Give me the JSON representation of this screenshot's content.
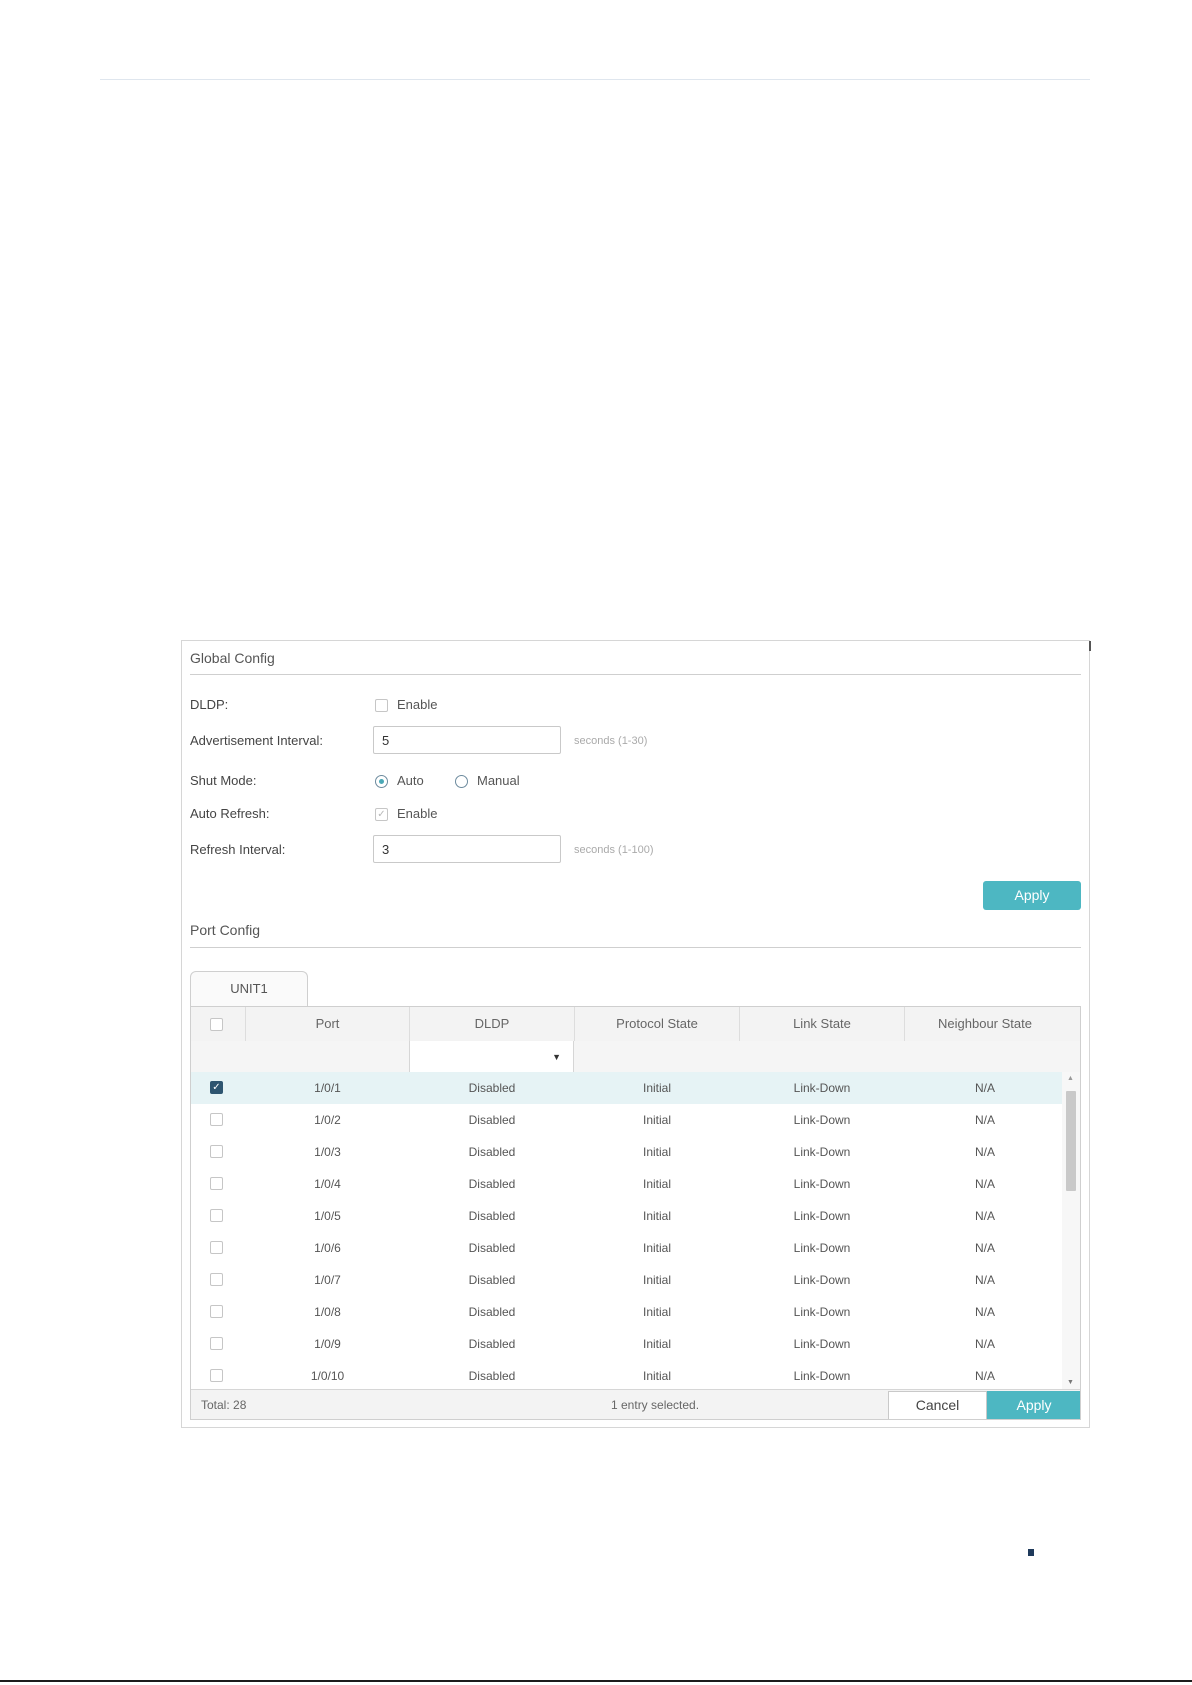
{
  "global_config": {
    "title": "Global Config",
    "dldp": {
      "label": "DLDP:",
      "option": "Enable",
      "checked": false
    },
    "advertisement_interval": {
      "label": "Advertisement Interval:",
      "value": "5",
      "hint": "seconds (1-30)"
    },
    "shut_mode": {
      "label": "Shut Mode:",
      "options": [
        "Auto",
        "Manual"
      ],
      "selected": "Auto"
    },
    "auto_refresh": {
      "label": "Auto Refresh:",
      "option": "Enable",
      "checked": true
    },
    "refresh_interval": {
      "label": "Refresh Interval:",
      "value": "3",
      "hint": "seconds (1-100)"
    },
    "apply_label": "Apply"
  },
  "port_config": {
    "title": "Port Config",
    "tab": "UNIT1",
    "columns": [
      "Port",
      "DLDP",
      "Protocol State",
      "Link State",
      "Neighbour State"
    ],
    "filter_value": "",
    "rows": [
      {
        "port": "1/0/1",
        "dldp": "Disabled",
        "protocol_state": "Initial",
        "link_state": "Link-Down",
        "neighbour_state": "N/A",
        "checked": true
      },
      {
        "port": "1/0/2",
        "dldp": "Disabled",
        "protocol_state": "Initial",
        "link_state": "Link-Down",
        "neighbour_state": "N/A",
        "checked": false
      },
      {
        "port": "1/0/3",
        "dldp": "Disabled",
        "protocol_state": "Initial",
        "link_state": "Link-Down",
        "neighbour_state": "N/A",
        "checked": false
      },
      {
        "port": "1/0/4",
        "dldp": "Disabled",
        "protocol_state": "Initial",
        "link_state": "Link-Down",
        "neighbour_state": "N/A",
        "checked": false
      },
      {
        "port": "1/0/5",
        "dldp": "Disabled",
        "protocol_state": "Initial",
        "link_state": "Link-Down",
        "neighbour_state": "N/A",
        "checked": false
      },
      {
        "port": "1/0/6",
        "dldp": "Disabled",
        "protocol_state": "Initial",
        "link_state": "Link-Down",
        "neighbour_state": "N/A",
        "checked": false
      },
      {
        "port": "1/0/7",
        "dldp": "Disabled",
        "protocol_state": "Initial",
        "link_state": "Link-Down",
        "neighbour_state": "N/A",
        "checked": false
      },
      {
        "port": "1/0/8",
        "dldp": "Disabled",
        "protocol_state": "Initial",
        "link_state": "Link-Down",
        "neighbour_state": "N/A",
        "checked": false
      },
      {
        "port": "1/0/9",
        "dldp": "Disabled",
        "protocol_state": "Initial",
        "link_state": "Link-Down",
        "neighbour_state": "N/A",
        "checked": false
      },
      {
        "port": "1/0/10",
        "dldp": "Disabled",
        "protocol_state": "Initial",
        "link_state": "Link-Down",
        "neighbour_state": "N/A",
        "checked": false
      }
    ],
    "total": "Total: 28",
    "selection_status": "1 entry selected.",
    "cancel_label": "Cancel",
    "apply_label": "Apply"
  },
  "colors": {
    "accent": "#4db7c2",
    "checkbox_checked": "#2e5570",
    "selected_row": "#e6f3f5"
  }
}
